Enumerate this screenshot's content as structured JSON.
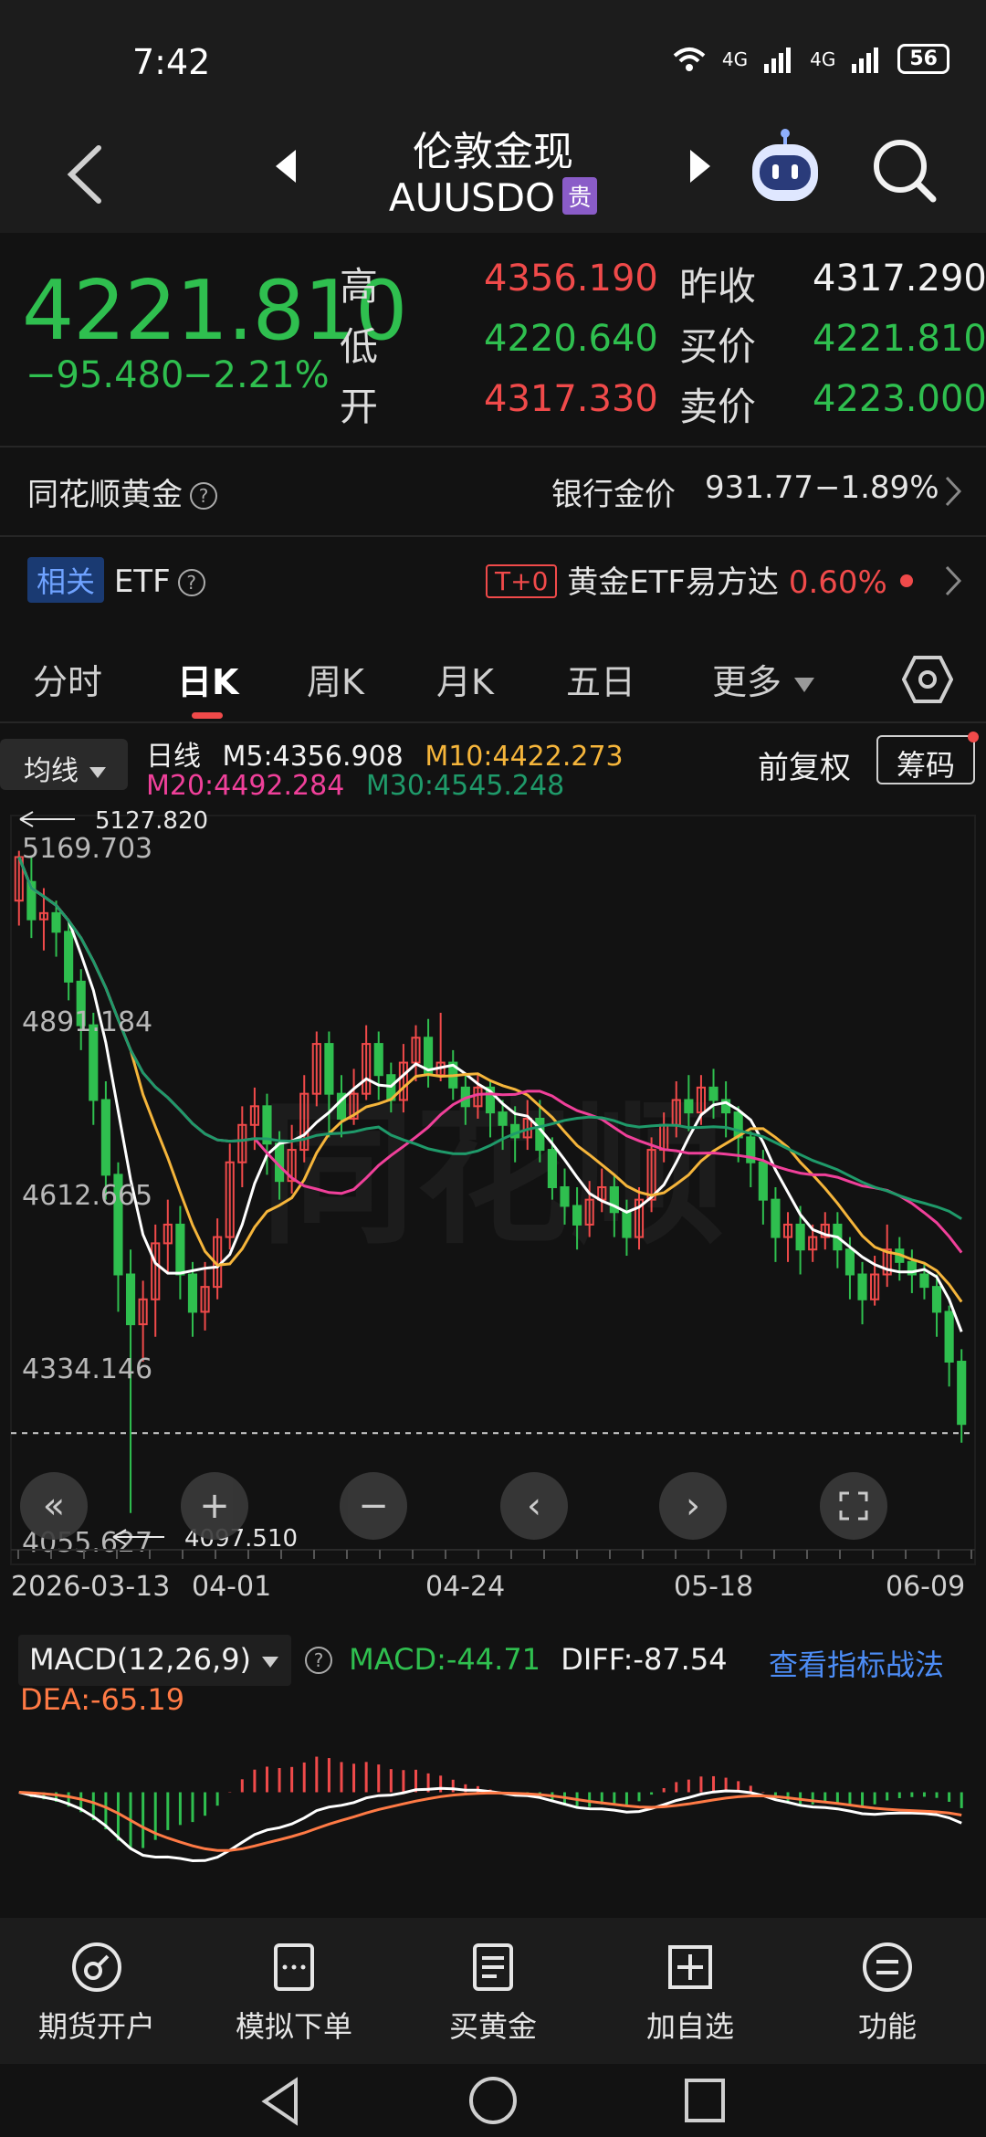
{
  "status": {
    "time": "7:42",
    "net1": "4G",
    "net2": "4G",
    "battery": "56"
  },
  "header": {
    "title": "伦敦金现",
    "subtitle": "AUUSDO",
    "badge": "贵"
  },
  "quote": {
    "price": "4221.810",
    "change": "−95.480",
    "change_pct": "−2.21%",
    "high_label": "高",
    "high": "4356.190",
    "low_label": "低",
    "low": "4220.640",
    "open_label": "开",
    "open": "4317.330",
    "prev_close_label": "昨收",
    "prev_close": "4317.290",
    "bid_label": "买价",
    "bid": "4221.810",
    "ask_label": "卖价",
    "ask": "4223.000"
  },
  "row_gold": {
    "left": "同花顺黄金",
    "bank_label": "银行金价",
    "bank_price": "931.77",
    "bank_pct": "−1.89%"
  },
  "row_etf": {
    "tag": "相关",
    "label": "ETF",
    "t0": "T+0",
    "etf_name": "黄金ETF易方达",
    "etf_pct": "0.60%"
  },
  "tabs": [
    "分时",
    "日K",
    "周K",
    "月K",
    "五日",
    "更多"
  ],
  "chart_header": {
    "ma_select": "均线",
    "period": "日线",
    "m5": "M5:4356.908",
    "m10": "M10:4422.273",
    "m20": "M20:4492.284",
    "m30": "M30:4545.248",
    "fuquan": "前复权",
    "chouma": "筹码"
  },
  "colors": {
    "up": "#f04a4a",
    "down": "#2fbf4f",
    "m5": "#ffffff",
    "m10": "#f5b53b",
    "m20": "#f0409a",
    "m30": "#1f9a6a"
  },
  "chart_data": {
    "type": "candlestick",
    "y_ticks": [
      "5169.703",
      "4891.184",
      "4612.665",
      "4334.146",
      "4055.627"
    ],
    "y_tick_values": [
      5169.703,
      4891.184,
      4612.665,
      4334.146,
      4055.627
    ],
    "x_labels": [
      "2026-03-13",
      "04-01",
      "04-24",
      "05-18",
      "06-09"
    ],
    "max_label": "5127.820",
    "min_label": "4097.510",
    "ylim": [
      4055.627,
      5169.703
    ],
    "candles": [
      [
        5080,
        5150,
        5040,
        5160
      ],
      [
        5110,
        5050,
        5020,
        5150
      ],
      [
        5050,
        5060,
        5000,
        5100
      ],
      [
        5060,
        5030,
        4990,
        5080
      ],
      [
        5030,
        4950,
        4920,
        5050
      ],
      [
        4950,
        4880,
        4840,
        4970
      ],
      [
        4880,
        4760,
        4720,
        4900
      ],
      [
        4760,
        4640,
        4600,
        4790
      ],
      [
        4640,
        4480,
        4420,
        4660
      ],
      [
        4480,
        4400,
        4097,
        4520
      ],
      [
        4400,
        4440,
        4340,
        4470
      ],
      [
        4440,
        4530,
        4380,
        4560
      ],
      [
        4530,
        4560,
        4480,
        4600
      ],
      [
        4560,
        4480,
        4440,
        4590
      ],
      [
        4480,
        4420,
        4380,
        4500
      ],
      [
        4420,
        4460,
        4390,
        4500
      ],
      [
        4460,
        4540,
        4440,
        4570
      ],
      [
        4540,
        4660,
        4520,
        4690
      ],
      [
        4660,
        4720,
        4620,
        4750
      ],
      [
        4720,
        4750,
        4680,
        4780
      ],
      [
        4750,
        4690,
        4640,
        4770
      ],
      [
        4690,
        4630,
        4600,
        4710
      ],
      [
        4630,
        4680,
        4610,
        4720
      ],
      [
        4680,
        4770,
        4660,
        4800
      ],
      [
        4770,
        4850,
        4750,
        4870
      ],
      [
        4850,
        4770,
        4700,
        4870
      ],
      [
        4770,
        4730,
        4700,
        4800
      ],
      [
        4730,
        4770,
        4720,
        4810
      ],
      [
        4770,
        4850,
        4760,
        4880
      ],
      [
        4850,
        4800,
        4760,
        4870
      ],
      [
        4800,
        4760,
        4740,
        4820
      ],
      [
        4760,
        4820,
        4740,
        4850
      ],
      [
        4820,
        4860,
        4790,
        4880
      ],
      [
        4860,
        4800,
        4780,
        4890
      ],
      [
        4800,
        4820,
        4790,
        4900
      ],
      [
        4820,
        4780,
        4760,
        4840
      ],
      [
        4780,
        4750,
        4720,
        4800
      ],
      [
        4750,
        4780,
        4730,
        4800
      ],
      [
        4780,
        4740,
        4700,
        4790
      ],
      [
        4740,
        4720,
        4680,
        4760
      ],
      [
        4720,
        4700,
        4660,
        4750
      ],
      [
        4700,
        4730,
        4680,
        4760
      ],
      [
        4730,
        4680,
        4660,
        4760
      ],
      [
        4680,
        4620,
        4600,
        4700
      ],
      [
        4620,
        4590,
        4560,
        4650
      ],
      [
        4590,
        4560,
        4520,
        4620
      ],
      [
        4560,
        4600,
        4540,
        4630
      ],
      [
        4600,
        4620,
        4580,
        4650
      ],
      [
        4620,
        4580,
        4540,
        4640
      ],
      [
        4580,
        4540,
        4510,
        4600
      ],
      [
        4540,
        4600,
        4520,
        4620
      ],
      [
        4600,
        4680,
        4580,
        4700
      ],
      [
        4680,
        4720,
        4660,
        4740
      ],
      [
        4720,
        4760,
        4700,
        4790
      ],
      [
        4760,
        4740,
        4710,
        4800
      ],
      [
        4740,
        4780,
        4720,
        4800
      ],
      [
        4780,
        4760,
        4730,
        4810
      ],
      [
        4760,
        4740,
        4700,
        4790
      ],
      [
        4740,
        4700,
        4660,
        4750
      ],
      [
        4700,
        4660,
        4620,
        4710
      ],
      [
        4660,
        4600,
        4560,
        4680
      ],
      [
        4600,
        4540,
        4500,
        4620
      ],
      [
        4540,
        4560,
        4500,
        4580
      ],
      [
        4560,
        4520,
        4480,
        4590
      ],
      [
        4520,
        4540,
        4500,
        4560
      ],
      [
        4540,
        4560,
        4520,
        4580
      ],
      [
        4560,
        4520,
        4490,
        4580
      ],
      [
        4520,
        4480,
        4440,
        4540
      ],
      [
        4480,
        4440,
        4400,
        4500
      ],
      [
        4440,
        4480,
        4430,
        4510
      ],
      [
        4480,
        4520,
        4460,
        4560
      ],
      [
        4520,
        4500,
        4470,
        4540
      ],
      [
        4500,
        4480,
        4450,
        4520
      ],
      [
        4480,
        4460,
        4440,
        4500
      ],
      [
        4460,
        4420,
        4380,
        4480
      ],
      [
        4420,
        4340,
        4300,
        4430
      ],
      [
        4340,
        4240,
        4210,
        4360
      ]
    ]
  },
  "macd": {
    "title": "MACD(12,26,9)",
    "macd": "MACD:-44.71",
    "diff": "DIFF:-87.54",
    "dea": "DEA:-65.19",
    "link": "查看指标战法"
  },
  "nav": [
    {
      "label": "期货开户",
      "icon": "account-icon"
    },
    {
      "label": "模拟下单",
      "icon": "simulate-icon"
    },
    {
      "label": "买黄金",
      "icon": "doc-icon"
    },
    {
      "label": "加自选",
      "icon": "plus-box-icon"
    },
    {
      "label": "功能",
      "icon": "menu-circle-icon"
    }
  ]
}
